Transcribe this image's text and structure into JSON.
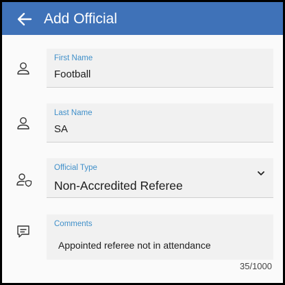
{
  "appbar": {
    "title": "Add Official",
    "back_icon": "arrow-left-icon",
    "color": "#3f72b8"
  },
  "form": {
    "first_name": {
      "label": "First Name",
      "value": "Football",
      "icon": "person-icon"
    },
    "last_name": {
      "label": "Last Name",
      "value": "SA",
      "icon": "person-icon"
    },
    "official_type": {
      "label": "Official Type",
      "value": "Non-Accredited Referee",
      "icon": "person-shield-icon",
      "dropdown_icon": "chevron-down-icon"
    },
    "comments": {
      "label": "Comments",
      "value": "Appointed referee not in attendance",
      "icon": "comment-icon",
      "counter": "35/1000"
    }
  },
  "colors": {
    "label_accent": "#3f8fc9",
    "field_bg": "#f1f1f1"
  }
}
